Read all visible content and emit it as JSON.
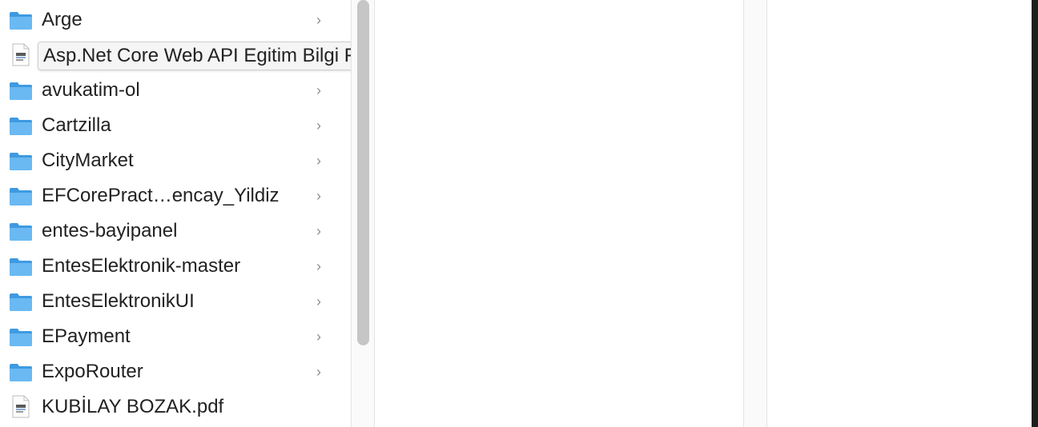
{
  "tooltip": "Asp.Net Core Web API Egitim Bilgi Formu.pdf",
  "items": [
    {
      "label": "Arge",
      "type": "folder",
      "chevron": "›"
    },
    {
      "label": "",
      "type": "pdf",
      "chevron": ""
    },
    {
      "label": "avukatim-ol",
      "type": "folder",
      "chevron": "›"
    },
    {
      "label": "Cartzilla",
      "type": "folder",
      "chevron": "›"
    },
    {
      "label": "CityMarket",
      "type": "folder",
      "chevron": "›"
    },
    {
      "label": "EFCorePract…encay_Yildiz",
      "type": "folder",
      "chevron": "›"
    },
    {
      "label": "entes-bayipanel",
      "type": "folder",
      "chevron": "›"
    },
    {
      "label": "EntesElektronik-master",
      "type": "folder",
      "chevron": "›"
    },
    {
      "label": "EntesElektronikUI",
      "type": "folder",
      "chevron": "›"
    },
    {
      "label": "EPayment",
      "type": "folder",
      "chevron": "›"
    },
    {
      "label": "ExpoRouter",
      "type": "folder",
      "chevron": "›"
    },
    {
      "label": "KUBİLAY BOZAK.pdf",
      "type": "pdf",
      "chevron": ""
    }
  ],
  "colors": {
    "folder": "#5fb4f0",
    "folder_dark": "#3f9ae0"
  }
}
